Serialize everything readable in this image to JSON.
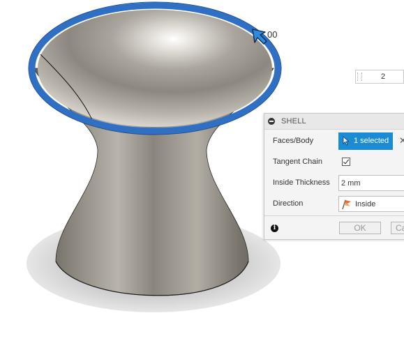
{
  "canvas": {
    "thickness_readout": "00",
    "distance_value": "2"
  },
  "dialog": {
    "title": "SHELL",
    "faces_label": "Faces/Body",
    "faces_value": "1 selected",
    "tangent_label": "Tangent Chain",
    "tangent_checked": true,
    "thickness_label": "Inside Thickness",
    "thickness_value": "2 mm",
    "direction_label": "Direction",
    "direction_value": "Inside",
    "ok_label": "OK",
    "cancel_label": "Ca"
  },
  "icons": {
    "collapse": "minus-circle-icon",
    "cursor": "pointer-cursor-icon",
    "clear": "close-icon",
    "direction": "direction-flag-icon",
    "info": "info-icon",
    "manipulator": "arrow-manipulator-icon"
  },
  "colors": {
    "accent": "#1b8bd3",
    "edge_highlight": "#2f6fc4"
  }
}
